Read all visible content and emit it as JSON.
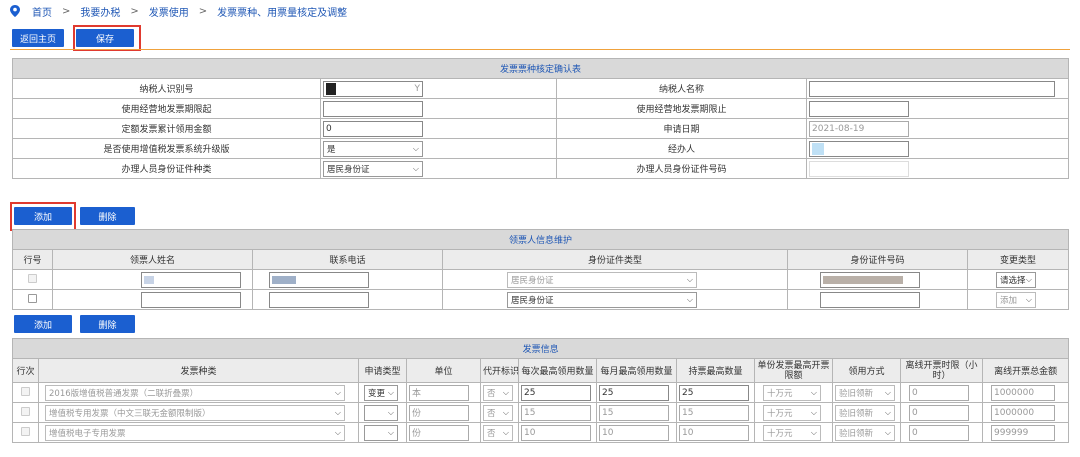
{
  "breadcrumb": [
    "首页",
    "我要办税",
    "发票使用",
    "发票票种、用票量核定及调整"
  ],
  "toolbar": {
    "back_label": "返回主页",
    "save_label": "保存"
  },
  "confirm_table": {
    "title": "发票票种核定确认表",
    "taxpayer_id_label": "纳税人识别号",
    "taxpayer_id_value": "Y",
    "taxpayer_name_label": "纳税人名称",
    "period_start_label": "使用经营地发票期限起",
    "period_end_label": "使用经营地发票期限止",
    "quota_label": "定额发票累计领用金额",
    "quota_value": "0",
    "apply_date_label": "申请日期",
    "apply_date_value": "2021-08-19",
    "upgrade_label": "是否使用增值税发票系统升级版",
    "upgrade_value": "是",
    "handler_label": "经办人",
    "id_type_label": "办理人员身份证件种类",
    "id_type_value": "居民身份证",
    "id_no_label": "办理人员身份证件号码"
  },
  "recipient_actions": {
    "add_label": "添加",
    "delete_label": "删除"
  },
  "recipient_table": {
    "title": "领票人信息维护",
    "headers": [
      "行号",
      "领票人姓名",
      "联系电话",
      "身份证件类型",
      "身份证件号码",
      "变更类型"
    ],
    "rows": [
      {
        "id_type": "居民身份证",
        "change": "请选择"
      },
      {
        "id_type": "居民身份证",
        "change": "添加"
      }
    ]
  },
  "invoice_actions": {
    "add_label": "添加",
    "delete_label": "删除"
  },
  "invoice_table": {
    "title": "发票信息",
    "headers": [
      "行次",
      "发票种类",
      "申请类型",
      "单位",
      "代开标识",
      "每次最高领用数量",
      "每月最高领用数量",
      "持票最高数量",
      "单份发票最高开票限额",
      "领用方式",
      "离线开票时限（小时）",
      "离线开票总金额"
    ],
    "rows": [
      {
        "kind": "2016版增值税普通发票（二联折叠票）",
        "apply": "变更",
        "unit": "本",
        "agent": "否",
        "per_time": "25",
        "per_month": "25",
        "hold": "25",
        "limit": "十万元",
        "method": "验旧领新",
        "offline_hours": "0",
        "offline_total": "1000000"
      },
      {
        "kind": "增值税专用发票（中文三联无金额限制版）",
        "apply": "",
        "unit": "份",
        "agent": "否",
        "per_time": "15",
        "per_month": "15",
        "hold": "15",
        "limit": "十万元",
        "method": "验旧领新",
        "offline_hours": "0",
        "offline_total": "1000000"
      },
      {
        "kind": "增值税电子专用发票",
        "apply": "",
        "unit": "份",
        "agent": "否",
        "per_time": "10",
        "per_month": "10",
        "hold": "10",
        "limit": "十万元",
        "method": "验旧领新",
        "offline_hours": "0",
        "offline_total": "999999"
      }
    ]
  },
  "colors": {
    "accent": "#1b5fd0",
    "highlight": "#e03a2f",
    "divider": "#f0a23c",
    "link": "#1f57b5"
  }
}
